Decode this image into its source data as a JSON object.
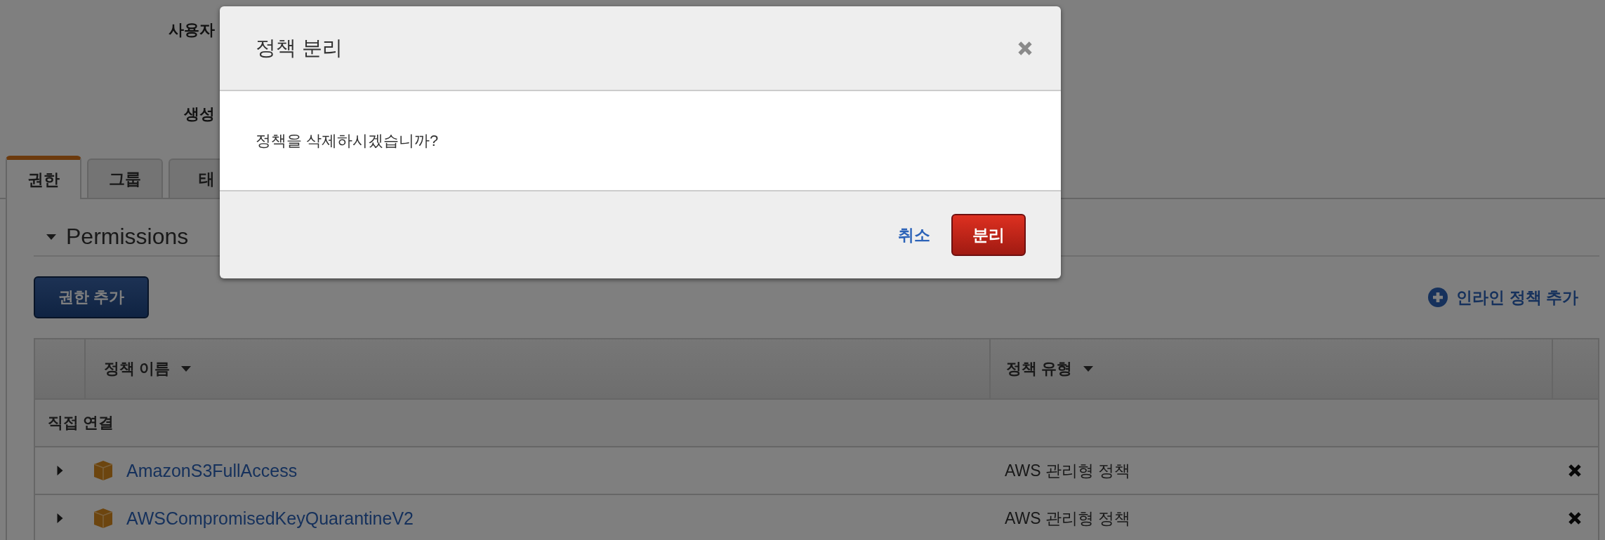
{
  "page": {
    "fields": [
      {
        "label": "사용자"
      },
      {
        "label": "생성"
      }
    ],
    "tabs": [
      {
        "label": "권한",
        "selected": true
      },
      {
        "label": "그룹",
        "selected": false
      },
      {
        "label": "태",
        "selected": false
      }
    ],
    "section": {
      "title": "Permissions",
      "expanded": true
    },
    "add_button": "권한 추가",
    "inline_link": "인라인 정책 추가",
    "table": {
      "columns": [
        "정책 이름",
        "정책 유형"
      ],
      "groups": [
        {
          "label": "직접 연결",
          "rows": [
            {
              "name": "AmazonS3FullAccess",
              "type": "AWS 관리형 정책",
              "expanded": false
            },
            {
              "name": "AWSCompromisedKeyQuarantineV2",
              "type": "AWS 관리형 정책",
              "expanded": false
            }
          ]
        }
      ]
    }
  },
  "dialog": {
    "title": "정책 분리",
    "message": "정책을 삭제하시겠습니까?",
    "buttons": [
      {
        "label": "취소",
        "kind": "link"
      },
      {
        "label": "분리",
        "kind": "danger"
      }
    ]
  }
}
